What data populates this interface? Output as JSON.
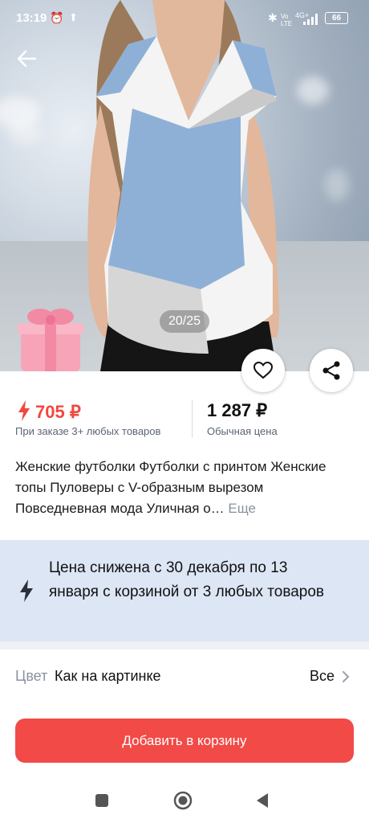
{
  "status_bar": {
    "time": "13:19",
    "battery": "66",
    "network": "4G+"
  },
  "gallery": {
    "counter": "20/25"
  },
  "price": {
    "sale": "705 ₽",
    "sale_note": "При заказе 3+ любых товаров",
    "regular": "1 287 ₽",
    "regular_note": "Обычная цена"
  },
  "product": {
    "title": "Женские футболки Футболки с принтом Женские топы Пуловеры с V-образным вырезом Повседневная мода Уличная о…",
    "more_label": "Еще"
  },
  "promo_banner": {
    "text": "Цена снижена с 30 декабря по 13 января с корзиной от 3 любых товаров"
  },
  "color": {
    "label": "Цвет",
    "value": "Как на картинке",
    "all_label": "Все"
  },
  "cart": {
    "button_label": "Добавить в корзину"
  },
  "colors": {
    "accent": "#f24a47",
    "sale_price": "#f0483e",
    "banner_bg": "#dde6f5",
    "shirt_blue": "#8fb0d6"
  }
}
